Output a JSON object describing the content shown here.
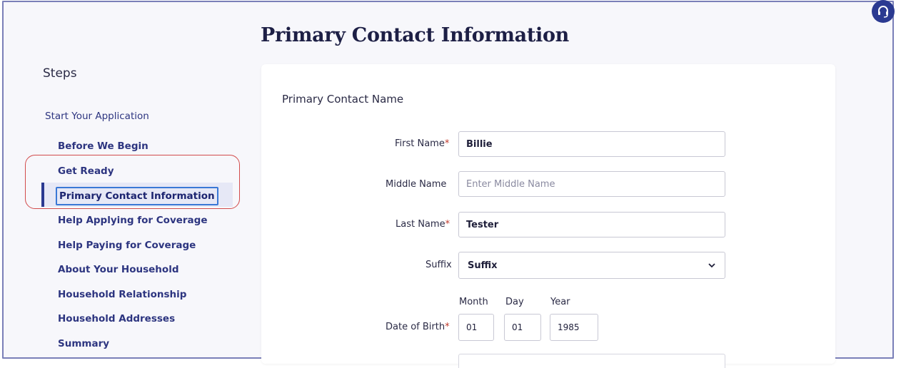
{
  "page": {
    "title": "Primary Contact Information"
  },
  "sidebar": {
    "heading": "Steps",
    "group_label": "Start Your Application",
    "items": [
      {
        "label": "Before We Begin"
      },
      {
        "label": "Get Ready"
      },
      {
        "label": "Primary Contact Information",
        "active": true
      },
      {
        "label": "Help Applying for Coverage"
      },
      {
        "label": "Help Paying for Coverage"
      },
      {
        "label": "About Your Household"
      },
      {
        "label": "Household Relationship"
      },
      {
        "label": "Household Addresses"
      },
      {
        "label": "Summary"
      }
    ]
  },
  "form": {
    "section_title": "Primary Contact Name",
    "first_name": {
      "label": "First Name",
      "required_mark": "*",
      "value": "Billie"
    },
    "middle_name": {
      "label": "Middle Name",
      "placeholder": "Enter Middle Name",
      "value": ""
    },
    "last_name": {
      "label": "Last Name",
      "required_mark": "*",
      "value": "Tester"
    },
    "suffix": {
      "label": "Suffix",
      "selected": "Suffix"
    },
    "dob": {
      "label": "Date of Birth",
      "required_mark": "*",
      "month_label": "Month",
      "month_value": "01",
      "day_label": "Day",
      "day_value": "01",
      "year_label": "Year",
      "year_value": "1985"
    }
  },
  "colors": {
    "brand": "#2b3a91",
    "highlight_outline": "#d24b4b",
    "required": "#c0392b",
    "focus_ring": "#3a78d6"
  },
  "icons": {
    "help": "headset-icon",
    "select": "chevron-down-icon"
  }
}
